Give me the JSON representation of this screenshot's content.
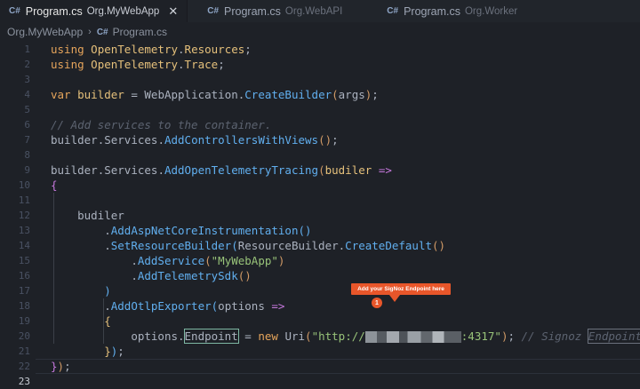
{
  "tabs": [
    {
      "icon": "C#",
      "name": "Program.cs",
      "project": "Org.MyWebApp",
      "close": "✕"
    },
    {
      "icon": "C#",
      "name": "Program.cs",
      "project": "Org.WebAPI"
    },
    {
      "icon": "C#",
      "name": "Program.cs",
      "project": "Org.Worker"
    }
  ],
  "breadcrumb": {
    "project": "Org.MyWebApp",
    "separator": "›",
    "icon": "C#",
    "file": "Program.cs"
  },
  "lines": {
    "n": [
      "1",
      "2",
      "3",
      "4",
      "5",
      "6",
      "7",
      "8",
      "9",
      "10",
      "11",
      "12",
      "13",
      "14",
      "15",
      "16",
      "17",
      "18",
      "19",
      "20",
      "21",
      "22"
    ],
    "using": "using",
    "ot1": "OpenTelemetry",
    "res": "Resources",
    "trace": "Trace",
    "var": "var",
    "builder": "builder",
    "webapp": "WebApplication",
    "createbuilder": "CreateBuilder",
    "args": "args",
    "comment1": "// Add services to the container.",
    "services": "Services",
    "addcv": "AddControllersWithViews",
    "addot": "AddOpenTelemetryTracing",
    "budiler": "budiler",
    "aspnet": "AddAspNetCoreInstrumentation",
    "setres": "SetResourceBuilder",
    "resbuilder": "ResourceBuilder",
    "createdefault": "CreateDefault",
    "addservice": "AddService",
    "svcname": "\"MyWebApp\"",
    "addsdk": "AddTelemetrySdk",
    "otlp": "AddOtlpExporter",
    "options": "options",
    "endpoint": "Endpoint",
    "new": "new",
    "uri": "Uri",
    "url_start": "\"http://",
    "url_end": ":4317\"",
    "comment2": "// Signoz ",
    "comment2b": "Endpoint"
  },
  "callout": {
    "text": "Add your SigNoz Endpoint here",
    "badge": "1"
  }
}
